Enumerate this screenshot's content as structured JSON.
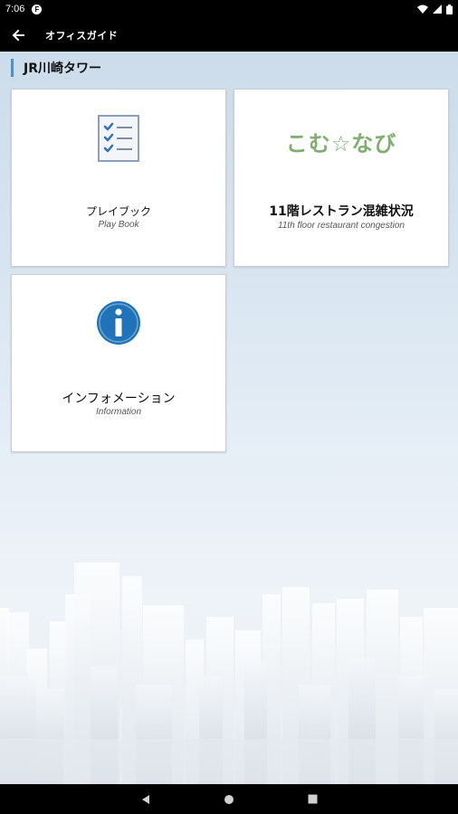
{
  "status_bar": {
    "time": "7:06",
    "notification_letter": "F"
  },
  "app_bar": {
    "title": "オフィスガイド"
  },
  "section": {
    "title": "JR川崎タワー"
  },
  "tiles": [
    {
      "title": "プレイブック",
      "subtitle": "Play Book",
      "icon": "checklist-icon"
    },
    {
      "logo_text": "こむ☆なび",
      "title": "11階レストラン混雑状況",
      "subtitle": "11th floor restaurant congestion",
      "icon": "komunavi-logo"
    },
    {
      "title": "インフォメーション",
      "subtitle": "Information",
      "icon": "info-icon"
    }
  ],
  "colors": {
    "accent": "#4a90d9",
    "logo_green": "#7eaf6f",
    "info_blue": "#1f73b8",
    "checklist_blue": "#2f6fc4"
  }
}
